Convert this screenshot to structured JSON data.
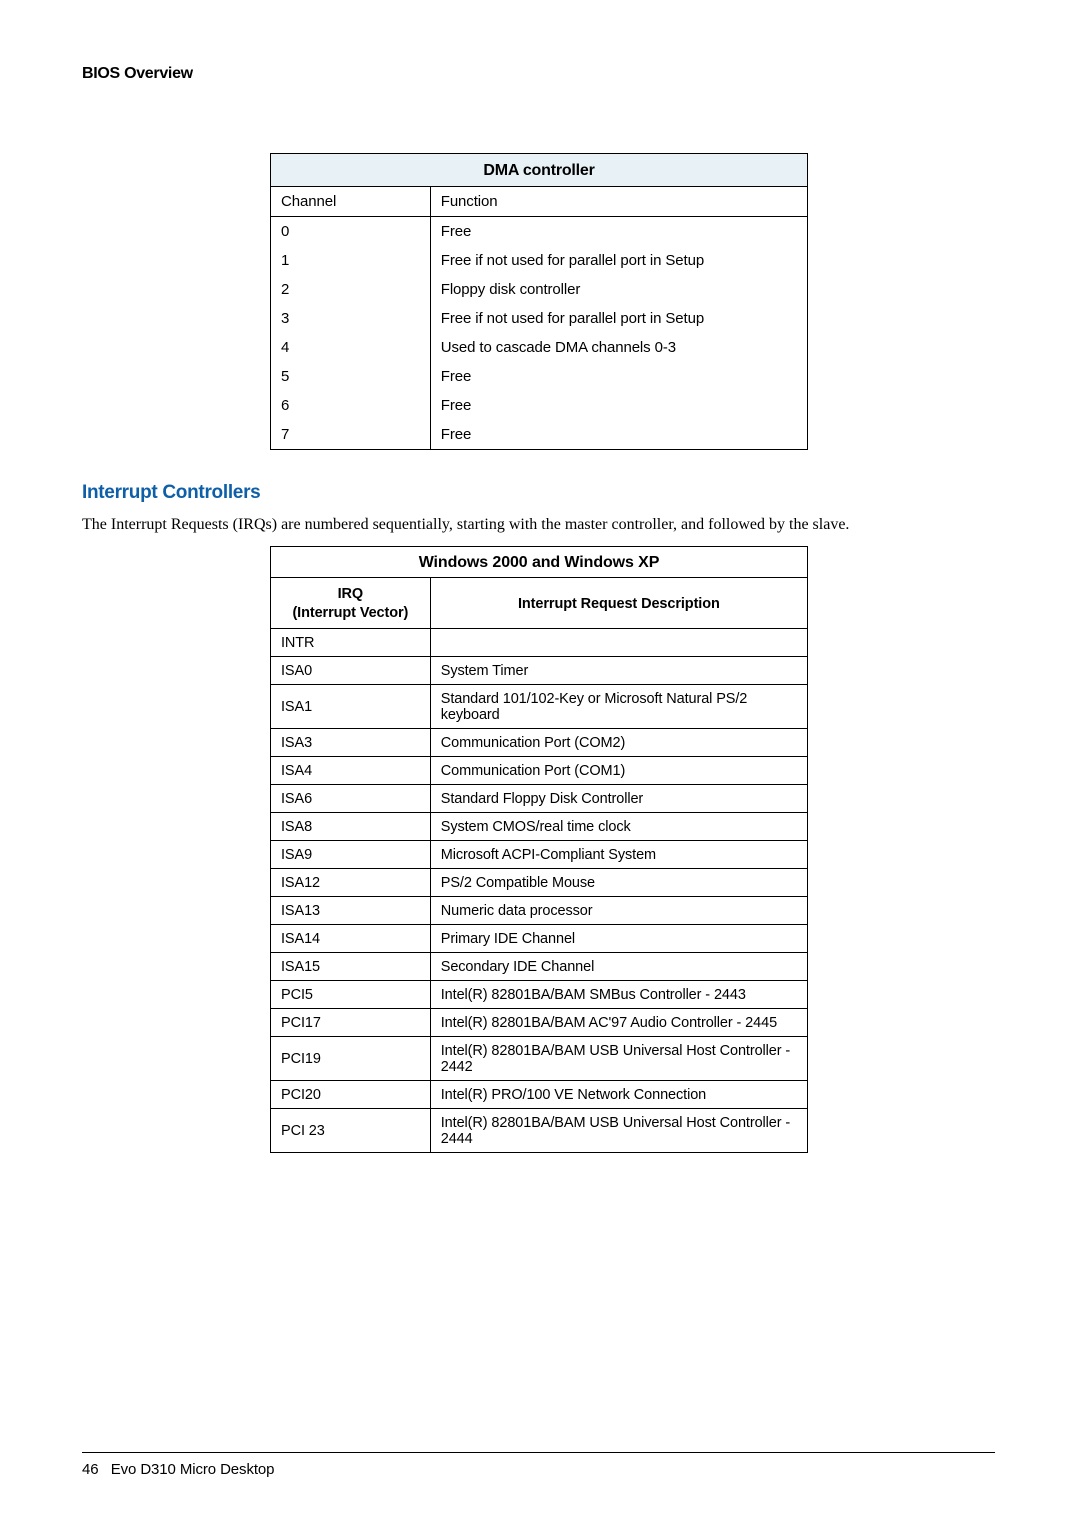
{
  "header": {
    "title": "BIOS Overview"
  },
  "dma_table": {
    "caption": "DMA controller",
    "col_headers": {
      "channel": "Channel",
      "function": "Function"
    },
    "rows": [
      {
        "channel": "0",
        "function": "Free"
      },
      {
        "channel": "1",
        "function": "Free if not used for parallel port in Setup"
      },
      {
        "channel": "2",
        "function": "Floppy disk controller"
      },
      {
        "channel": "3",
        "function": "Free if not used for parallel port in Setup"
      },
      {
        "channel": "4",
        "function": "Used to cascade DMA channels 0-3"
      },
      {
        "channel": "5",
        "function": "Free"
      },
      {
        "channel": "6",
        "function": "Free"
      },
      {
        "channel": "7",
        "function": "Free"
      }
    ]
  },
  "section": {
    "title": "Interrupt Controllers",
    "paragraph": "The Interrupt Requests (IRQs) are numbered sequentially, starting with the master controller, and followed by the slave."
  },
  "irq_table": {
    "caption": "Windows 2000 and Windows XP",
    "col_headers": {
      "irq_line1": "IRQ",
      "irq_line2": "(Interrupt Vector)",
      "desc": "Interrupt Request Description"
    },
    "rows": [
      {
        "irq": "INTR",
        "desc": ""
      },
      {
        "irq": "ISA0",
        "desc": "System Timer"
      },
      {
        "irq": "ISA1",
        "desc": "Standard 101/102-Key or Microsoft Natural PS/2 keyboard"
      },
      {
        "irq": "ISA3",
        "desc": "Communication Port (COM2)"
      },
      {
        "irq": "ISA4",
        "desc": "Communication Port (COM1)"
      },
      {
        "irq": "ISA6",
        "desc": "Standard Floppy Disk Controller"
      },
      {
        "irq": "ISA8",
        "desc": "System CMOS/real time clock"
      },
      {
        "irq": "ISA9",
        "desc": "Microsoft ACPI-Compliant System"
      },
      {
        "irq": "ISA12",
        "desc": "PS/2 Compatible Mouse"
      },
      {
        "irq": "ISA13",
        "desc": "Numeric data processor"
      },
      {
        "irq": "ISA14",
        "desc": "Primary IDE Channel"
      },
      {
        "irq": "ISA15",
        "desc": "Secondary IDE Channel"
      },
      {
        "irq": "PCI5",
        "desc": "Intel(R) 82801BA/BAM SMBus Controller - 2443"
      },
      {
        "irq": "PCI17",
        "desc": "Intel(R) 82801BA/BAM AC'97 Audio Controller - 2445"
      },
      {
        "irq": "PCI19",
        "desc": "Intel(R) 82801BA/BAM USB Universal Host Controller - 2442"
      },
      {
        "irq": "PCI20",
        "desc": "Intel(R) PRO/100 VE Network Connection"
      },
      {
        "irq": "PCI 23",
        "desc": "Intel(R) 82801BA/BAM USB Universal Host Controller - 2444"
      }
    ]
  },
  "footer": {
    "page_number": "46",
    "doc_title": "Evo D310 Micro Desktop"
  }
}
